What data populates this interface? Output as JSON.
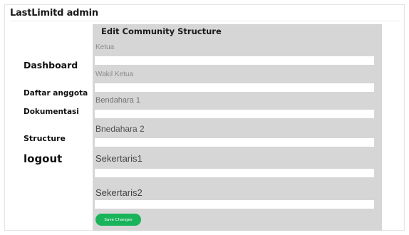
{
  "app": {
    "title": "LastLimitd admin"
  },
  "sidebar": {
    "items": [
      {
        "label": "Dashboard"
      },
      {
        "label": "Daftar anggota"
      },
      {
        "label": "Dokumentasi"
      },
      {
        "label": "Structure"
      },
      {
        "label": "logout"
      }
    ]
  },
  "form": {
    "title": "Edit Community Structure",
    "fields": [
      {
        "label": "Ketua",
        "value": ""
      },
      {
        "label": "Wakil Ketua",
        "value": ""
      },
      {
        "label": "Bendahara 1",
        "value": ""
      },
      {
        "label": "Bnedahara 2",
        "value": ""
      },
      {
        "label": "Sekertaris1",
        "value": ""
      },
      {
        "label": "Sekertaris2",
        "value": ""
      }
    ],
    "submit_label": "Save Changes"
  },
  "colors": {
    "panel_background": "#d6d6d6",
    "input_background": "#ffffff",
    "save_button": "#19b35a"
  }
}
